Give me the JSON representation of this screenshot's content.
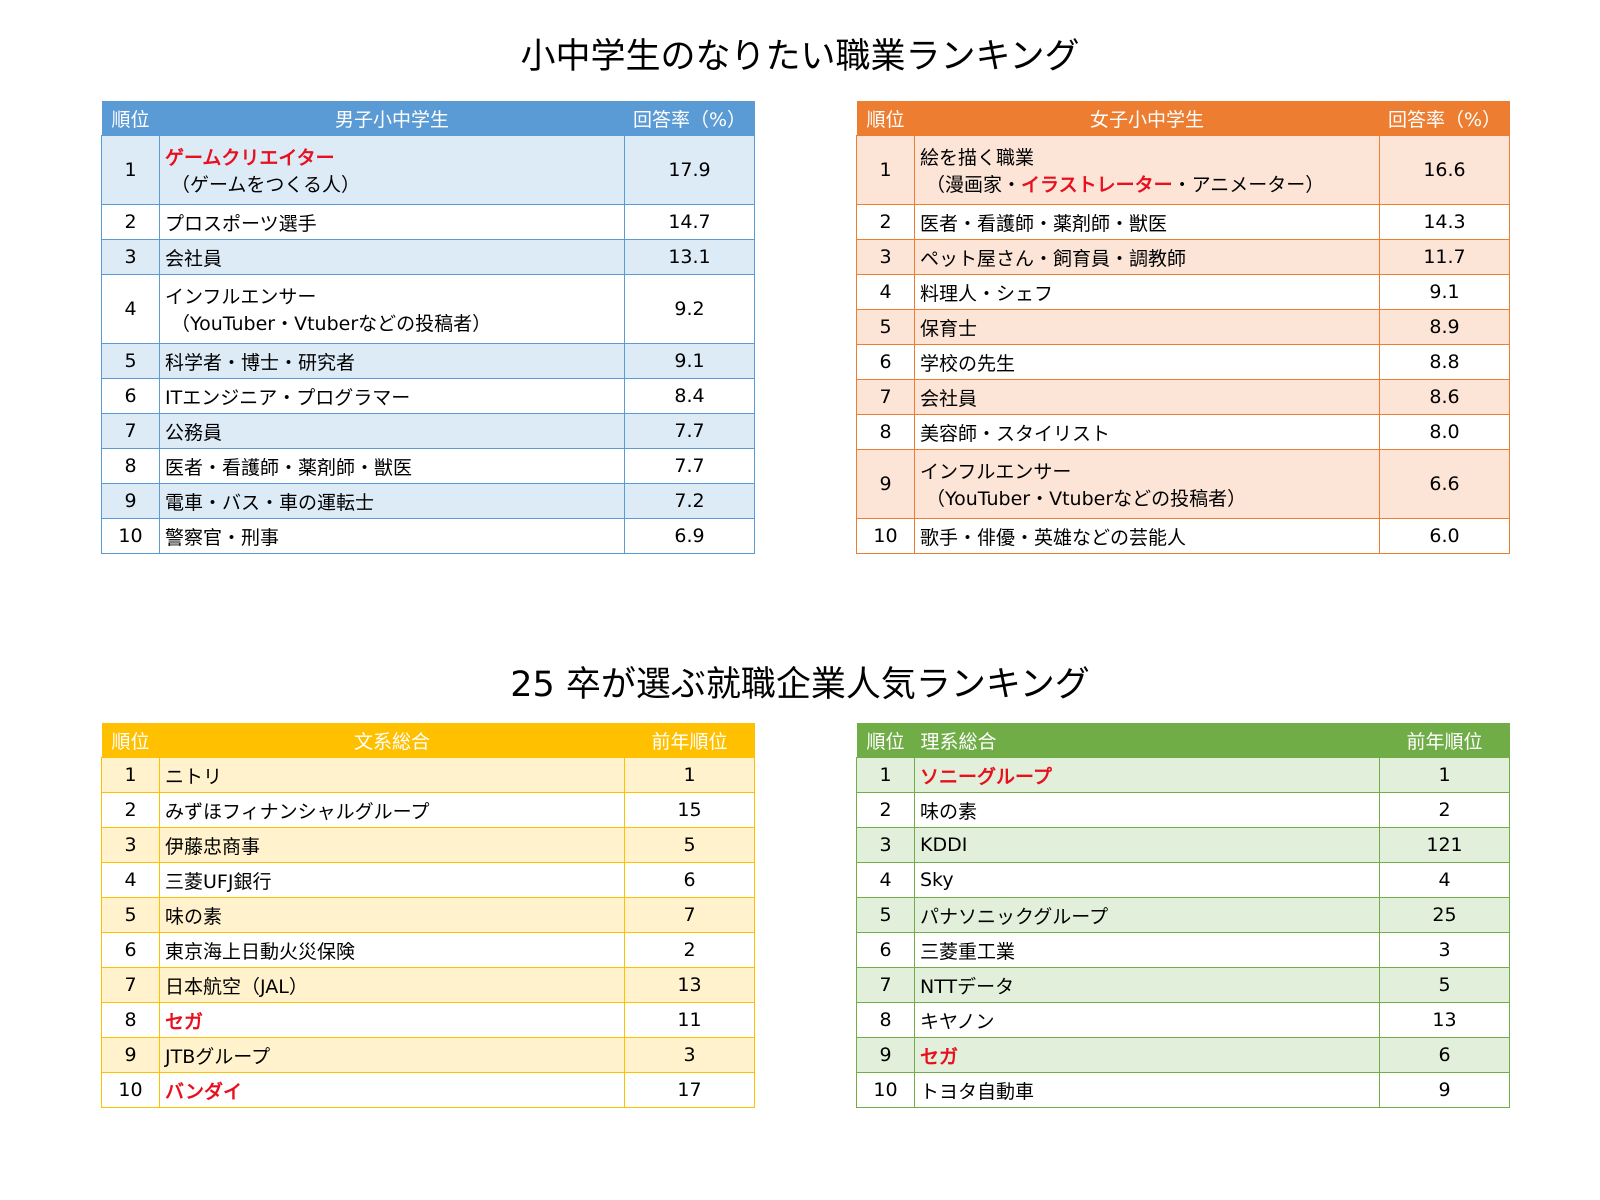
{
  "titles": {
    "top": "小中学生のなりたい職業ランキング",
    "bottom": "25 卒が選ぶ就職企業人気ランキング"
  },
  "colors": {
    "blue_header": "#5b9bd5",
    "blue_band": "#ddebf7",
    "orange_header": "#ed7d31",
    "orange_band": "#fce4d6",
    "yellow_header": "#ffc000",
    "yellow_band": "#fff2cc",
    "green_header": "#70ad47",
    "green_band": "#e2efda",
    "highlight_red": "#e8101e"
  },
  "boys": {
    "headers": [
      "順位",
      "男子小中学生",
      "回答率（%）"
    ],
    "rows": [
      {
        "rank": "1",
        "name": "ゲームクリエイター",
        "sub": "（ゲームをつくる人）",
        "value": "17.9"
      },
      {
        "rank": "2",
        "name": "プロスポーツ選手",
        "value": "14.7"
      },
      {
        "rank": "3",
        "name": "会社員",
        "value": "13.1"
      },
      {
        "rank": "4",
        "name": "インフルエンサー",
        "sub": "（YouTuber・Vtuberなどの投稿者）",
        "value": "9.2"
      },
      {
        "rank": "5",
        "name": "科学者・博士・研究者",
        "value": "9.1"
      },
      {
        "rank": "6",
        "name": "ITエンジニア・プログラマー",
        "value": "8.4"
      },
      {
        "rank": "7",
        "name": "公務員",
        "value": "7.7"
      },
      {
        "rank": "8",
        "name": "医者・看護師・薬剤師・獣医",
        "value": "7.7"
      },
      {
        "rank": "9",
        "name": "電車・バス・車の運転士",
        "value": "7.2"
      },
      {
        "rank": "10",
        "name": "警察官・刑事",
        "value": "6.9"
      }
    ]
  },
  "girls": {
    "headers": [
      "順位",
      "女子小中学生",
      "回答率（%）"
    ],
    "rows": [
      {
        "rank": "1",
        "name": "絵を描く職業",
        "sub_pre": "（漫画家・",
        "sub_red": "イラストレーター",
        "sub_post": "・アニメーター）",
        "value": "16.6"
      },
      {
        "rank": "2",
        "name": "医者・看護師・薬剤師・獣医",
        "value": "14.3"
      },
      {
        "rank": "3",
        "name": "ペット屋さん・飼育員・調教師",
        "value": "11.7"
      },
      {
        "rank": "4",
        "name": "料理人・シェフ",
        "value": "9.1"
      },
      {
        "rank": "5",
        "name": "保育士",
        "value": "8.9"
      },
      {
        "rank": "6",
        "name": "学校の先生",
        "value": "8.8"
      },
      {
        "rank": "7",
        "name": "会社員",
        "value": "8.6"
      },
      {
        "rank": "8",
        "name": "美容師・スタイリスト",
        "value": "8.0"
      },
      {
        "rank": "9",
        "name": "インフルエンサー",
        "sub": "（YouTuber・Vtuberなどの投稿者）",
        "value": "6.6"
      },
      {
        "rank": "10",
        "name": "歌手・俳優・英雄などの芸能人",
        "value": "6.0"
      }
    ]
  },
  "humanities": {
    "headers": [
      "順位",
      "文系総合",
      "前年順位"
    ],
    "rows": [
      {
        "rank": "1",
        "name": "ニトリ",
        "value": "1"
      },
      {
        "rank": "2",
        "name": "みずほフィナンシャルグループ",
        "value": "15"
      },
      {
        "rank": "3",
        "name": "伊藤忠商事",
        "value": "5"
      },
      {
        "rank": "4",
        "name": "三菱UFJ銀行",
        "value": "6"
      },
      {
        "rank": "5",
        "name": "味の素",
        "value": "7"
      },
      {
        "rank": "6",
        "name": "東京海上日動火災保険",
        "value": "2"
      },
      {
        "rank": "7",
        "name": "日本航空（JAL）",
        "value": "13"
      },
      {
        "rank": "8",
        "name": "セガ",
        "value": "11"
      },
      {
        "rank": "9",
        "name": "JTBグループ",
        "value": "3"
      },
      {
        "rank": "10",
        "name": "バンダイ",
        "value": "17"
      }
    ]
  },
  "sciences": {
    "headers": [
      "順位",
      "理系総合",
      "前年順位"
    ],
    "rows": [
      {
        "rank": "1",
        "name": "ソニーグループ",
        "value": "1"
      },
      {
        "rank": "2",
        "name": "味の素",
        "value": "2"
      },
      {
        "rank": "3",
        "name": "KDDI",
        "value": "121"
      },
      {
        "rank": "4",
        "name": "Sky",
        "value": "4"
      },
      {
        "rank": "5",
        "name": "パナソニックグループ",
        "value": "25"
      },
      {
        "rank": "6",
        "name": "三菱重工業",
        "value": "3"
      },
      {
        "rank": "7",
        "name": "NTTデータ",
        "value": "5"
      },
      {
        "rank": "8",
        "name": "キヤノン",
        "value": "13"
      },
      {
        "rank": "9",
        "name": "セガ",
        "value": "6"
      },
      {
        "rank": "10",
        "name": "トヨタ自動車",
        "value": "9"
      }
    ]
  }
}
